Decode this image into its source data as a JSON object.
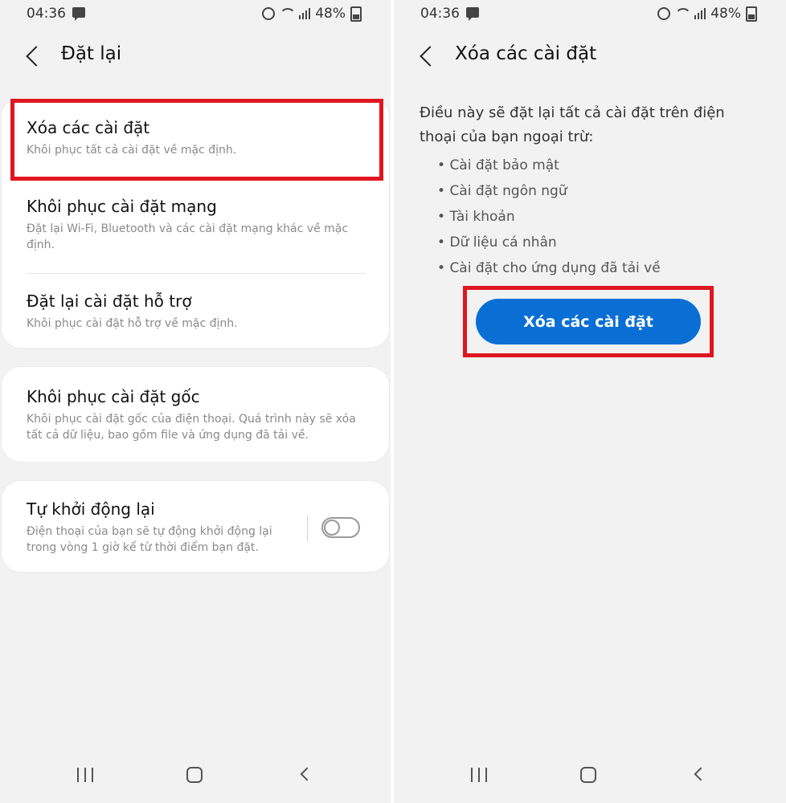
{
  "status": {
    "time": "04:36",
    "battery": "48%"
  },
  "left": {
    "title": "Đặt lại",
    "items": [
      {
        "title": "Xóa các cài đặt",
        "desc": "Khôi phục tất cả cài đặt về mặc định."
      },
      {
        "title": "Khôi phục cài đặt mạng",
        "desc": "Đặt lại Wi-Fi, Bluetooth và các cài đặt mạng khác về mặc định."
      },
      {
        "title": "Đặt lại cài đặt hỗ trợ",
        "desc": "Khôi phục cài đặt hỗ trợ về mặc định."
      },
      {
        "title": "Khôi phục cài đặt gốc",
        "desc": "Khôi phục cài đặt gốc của điện thoại. Quá trình này sẽ xóa tất cả dữ liệu, bao gồm file và ứng dụng đã tải về."
      },
      {
        "title": "Tự khởi động lại",
        "desc": "Điện thoại của bạn sẽ tự động khởi động lại trong vòng 1 giờ kể từ thời điểm bạn đặt.",
        "toggle_on": false
      }
    ]
  },
  "right": {
    "title": "Xóa các cài đặt",
    "description": "Điều này sẽ đặt lại tất cả cài đặt trên điện thoại của bạn ngoại trừ:",
    "exceptions": [
      "Cài đặt bảo mật",
      "Cài đặt ngôn ngữ",
      "Tài khoản",
      "Dữ liệu cá nhân",
      "Cài đặt cho ứng dụng đã tải về"
    ],
    "button_label": "Xóa các cài đặt"
  },
  "colors": {
    "highlight": "#e0161f",
    "primary_button": "#0a6fd5",
    "background": "#f2f2f2"
  }
}
